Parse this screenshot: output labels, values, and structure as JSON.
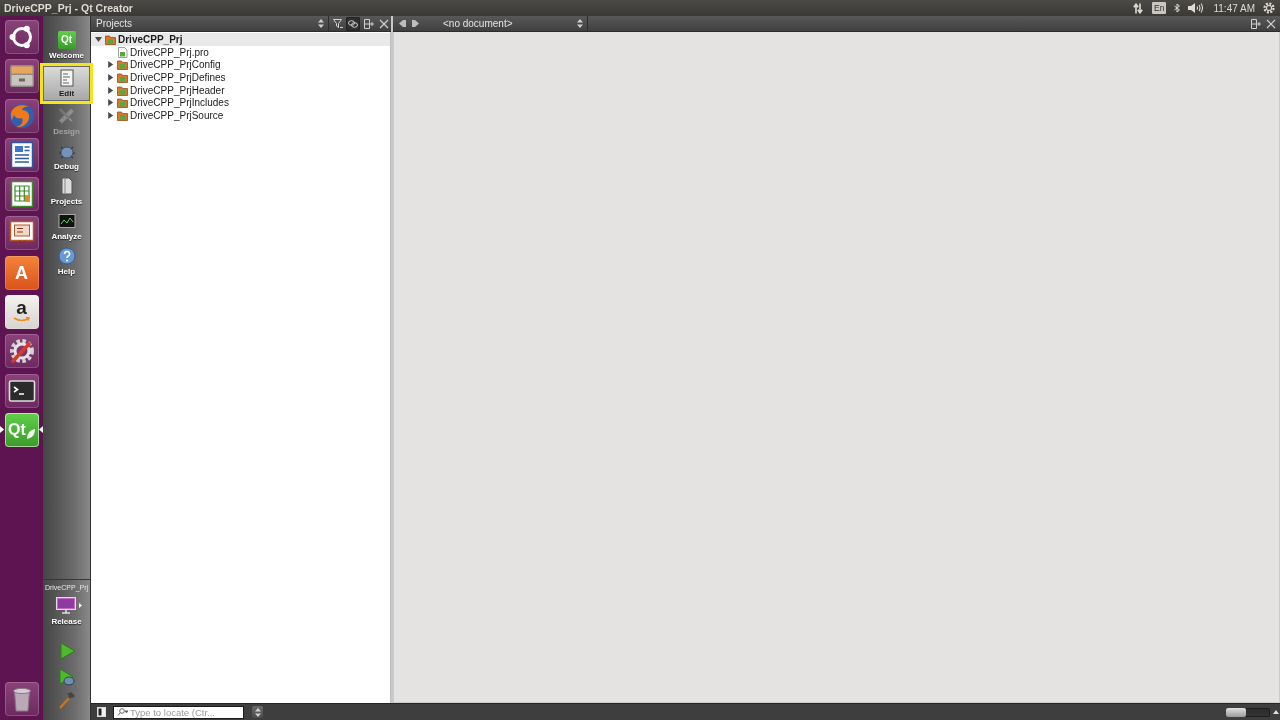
{
  "window": {
    "title": "DriveCPP_Prj - Qt Creator"
  },
  "top_panel": {
    "keyboard_layout": "En",
    "clock": "11:47 AM"
  },
  "launcher": {
    "items": [
      {
        "kind": "dash",
        "selected": false
      },
      {
        "kind": "files",
        "selected": false
      },
      {
        "kind": "browser",
        "selected": false
      },
      {
        "kind": "writer",
        "selected": false
      },
      {
        "kind": "calc",
        "selected": false
      },
      {
        "kind": "impress",
        "selected": false
      },
      {
        "kind": "software",
        "logo": "A",
        "selected": false
      },
      {
        "kind": "store",
        "logo": "a",
        "selected": false
      },
      {
        "kind": "settings",
        "selected": false
      },
      {
        "kind": "terminal",
        "selected": false
      },
      {
        "kind": "qt",
        "logo": "Qt",
        "selected": true
      }
    ]
  },
  "mode_bar": {
    "items": [
      {
        "kind": "welcome",
        "label": "Welcome",
        "logo": "Qt",
        "selected": false,
        "disabled": false,
        "highlighted": false
      },
      {
        "kind": "edit",
        "label": "Edit",
        "selected": true,
        "disabled": false,
        "highlighted": true
      },
      {
        "kind": "design",
        "label": "Design",
        "selected": false,
        "disabled": true,
        "highlighted": false
      },
      {
        "kind": "debug",
        "label": "Debug",
        "selected": false,
        "disabled": false,
        "highlighted": false
      },
      {
        "kind": "projects",
        "label": "Projects",
        "selected": false,
        "disabled": false,
        "highlighted": false
      },
      {
        "kind": "analyze",
        "label": "Analyze",
        "selected": false,
        "disabled": false,
        "highlighted": false
      },
      {
        "kind": "help",
        "label": "Help",
        "selected": false,
        "disabled": false,
        "highlighted": false
      }
    ],
    "target": {
      "project": "DriveCPP_Prj",
      "build": "Release"
    }
  },
  "projects_pane": {
    "title": "Projects",
    "link_button": {
      "on": true
    },
    "tree": [
      {
        "kind": "project",
        "label": "DriveCPP_Prj",
        "expanded": true,
        "selected": true,
        "children": [
          {
            "kind": "file",
            "label": "DriveCPP_Prj.pro",
            "selected": false
          },
          {
            "kind": "folder",
            "label": "DriveCPP_PrjConfig",
            "expanded": false,
            "selected": false
          },
          {
            "kind": "folder",
            "label": "DriveCPP_PrjDefines",
            "expanded": false,
            "selected": false
          },
          {
            "kind": "folder",
            "label": "DriveCPP_PrjHeader",
            "expanded": false,
            "selected": false
          },
          {
            "kind": "folder",
            "label": "DriveCPP_PrjIncludes",
            "expanded": false,
            "selected": false
          },
          {
            "kind": "folder",
            "label": "DriveCPP_PrjSource",
            "expanded": false,
            "selected": false
          }
        ]
      }
    ]
  },
  "editor": {
    "document": "<no document>"
  },
  "status_bar": {
    "locator": {
      "placeholder": "Type to locate (Ctr..."
    },
    "progress_toggle": {
      "on": false
    }
  }
}
